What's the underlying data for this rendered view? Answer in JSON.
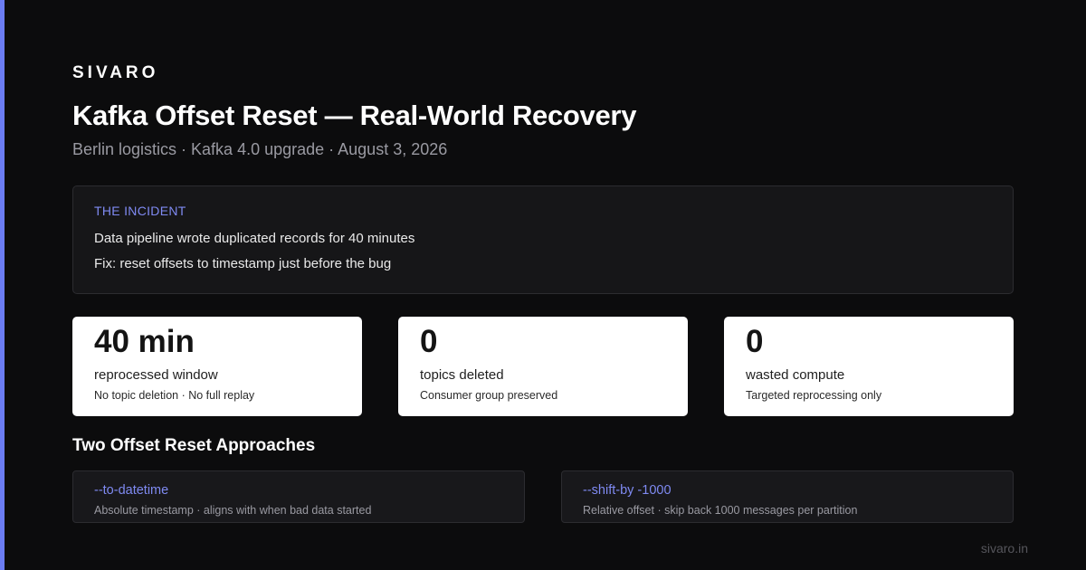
{
  "brand": "SIVARO",
  "title": "Kafka Offset Reset — Real-World Recovery",
  "subtitle": "Berlin logistics · Kafka 4.0 upgrade · August 3, 2026",
  "incident": {
    "label": "THE INCIDENT",
    "lines": [
      "Data pipeline wrote duplicated records for 40 minutes",
      "Fix: reset offsets to timestamp just before the bug"
    ]
  },
  "stats": [
    {
      "value": "40 min",
      "label": "reprocessed window",
      "note": "No topic deletion · No full replay"
    },
    {
      "value": "0",
      "label": "topics deleted",
      "note": "Consumer group preserved"
    },
    {
      "value": "0",
      "label": "wasted compute",
      "note": "Targeted reprocessing only"
    }
  ],
  "approaches": {
    "heading": "Two Offset Reset Approaches",
    "items": [
      {
        "flag": "--to-datetime",
        "desc": "Absolute timestamp · aligns with when bad data started"
      },
      {
        "flag": "--shift-by -1000",
        "desc": "Relative offset · skip back 1000 messages per partition"
      }
    ]
  },
  "footer": "sivaro.in",
  "colors": {
    "background": "#0c0c0d",
    "accent": "#6b7cf2",
    "card": "#ffffff",
    "panel": "#161618"
  }
}
